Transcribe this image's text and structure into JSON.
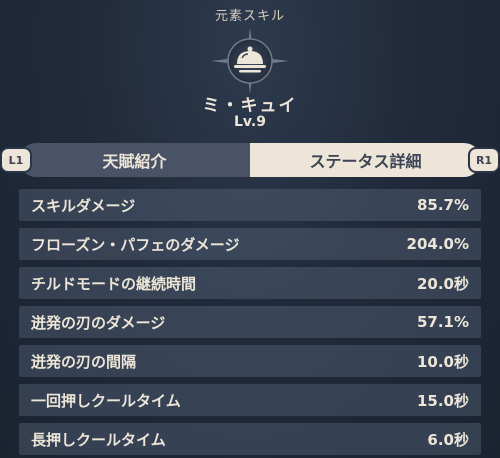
{
  "header": {
    "category": "元素スキル",
    "skill_icon": "chef-cloche-icon",
    "skill_name": "ミ・キュイ",
    "level": "Lv.9"
  },
  "tabs": [
    {
      "label": "天賦紹介",
      "active": false
    },
    {
      "label": "ステータス詳細",
      "active": true
    }
  ],
  "key_hints": {
    "left": "L1",
    "right": "R1"
  },
  "stats": [
    {
      "label": "スキルダメージ",
      "value": "85.7%"
    },
    {
      "label": "フローズン・パフェのダメージ",
      "value": "204.0%"
    },
    {
      "label": "チルドモードの継続時間",
      "value": "20.0秒"
    },
    {
      "label": "迸発の刃のダメージ",
      "value": "57.1%"
    },
    {
      "label": "迸発の刃の間隔",
      "value": "10.0秒"
    },
    {
      "label": "一回押しクールタイム",
      "value": "15.0秒"
    },
    {
      "label": "長押しクールタイム",
      "value": "6.0秒"
    }
  ],
  "colors": {
    "background": "#212b3b",
    "text": "#ece5d8",
    "tab_active": "#ece5d8",
    "tab_inactive": "#4a5366"
  }
}
